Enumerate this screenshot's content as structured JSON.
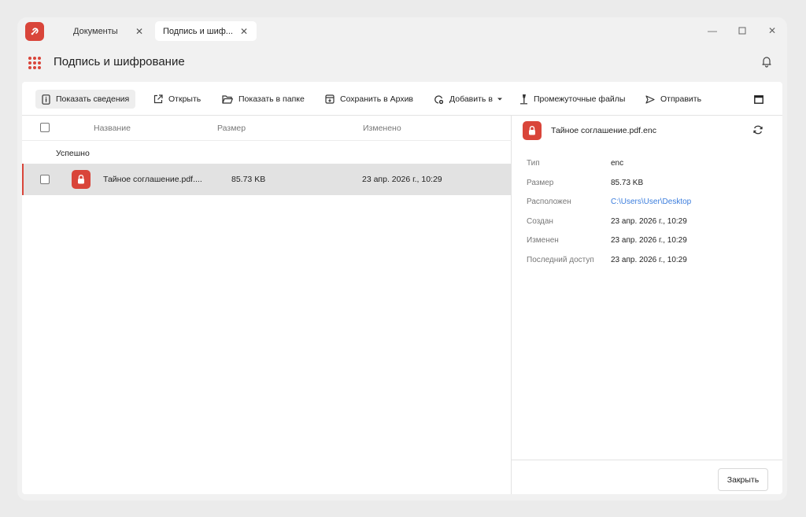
{
  "tabs": [
    {
      "label": "Документы"
    },
    {
      "label": "Подпись и шиф..."
    }
  ],
  "header": {
    "title": "Подпись и шифрование"
  },
  "toolbar": {
    "show_details": "Показать сведения",
    "open": "Открыть",
    "show_in_folder": "Показать в папке",
    "save_to_archive": "Сохранить в Архив",
    "add_to": "Добавить в",
    "intermediate_files": "Промежуточные файлы",
    "send": "Отправить"
  },
  "list": {
    "columns": {
      "name": "Название",
      "size": "Размер",
      "modified": "Изменено"
    },
    "group": "Успешно",
    "rows": [
      {
        "name": "Тайное соглашение.pdf....",
        "size": "85.73 KB",
        "modified": "23 апр. 2026 г., 10:29"
      }
    ]
  },
  "details": {
    "file_name": "Тайное соглашение.pdf.enc",
    "fields": [
      {
        "key": "Тип",
        "value": "enc"
      },
      {
        "key": "Размер",
        "value": "85.73 KB"
      },
      {
        "key": "Расположен",
        "value": "C:\\Users\\User\\Desktop"
      },
      {
        "key": "Создан",
        "value": "23 апр. 2026 г., 10:29"
      },
      {
        "key": "Изменен",
        "value": "23 апр. 2026 г., 10:29"
      },
      {
        "key": "Последний доступ",
        "value": "23 апр. 2026 г., 10:29"
      }
    ],
    "close_label": "Закрыть"
  },
  "colors": {
    "accent": "#d9453a",
    "link": "#3b7ddd",
    "selected_row": "#e2e2e2"
  }
}
